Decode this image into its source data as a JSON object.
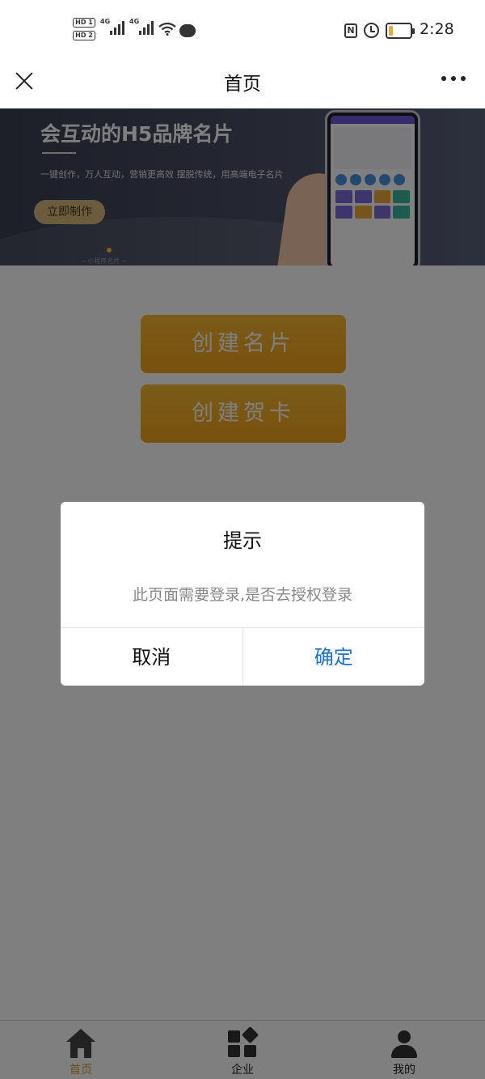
{
  "status_bar": {
    "hd1": "HD 1",
    "hd2": "HD 2",
    "net1": "4G",
    "net2": "4G",
    "nfc": "N",
    "time": "2:28",
    "battery_level": 0.2,
    "battery_color": "#f5a623",
    "icons": [
      "signal-icon",
      "wifi-icon",
      "message-icon",
      "nfc-icon",
      "alarm-icon",
      "battery-icon"
    ]
  },
  "navbar": {
    "title": "首页",
    "close_icon": "close-icon",
    "more_icon": "more-icon"
  },
  "banner": {
    "title": "会互动的H5品牌名片",
    "subtitle": "一键创作，万人互动，营销更高效   摆脱传统，用高端电子名片",
    "button_label": "立即制作",
    "caption": "-- 小程序名片 --"
  },
  "actions": {
    "create_card": "创建名片",
    "create_greeting_card": "创建贺卡",
    "accent_color": "#f0a21a"
  },
  "dialog": {
    "title": "提示",
    "message": "此页面需要登录,是否去授权登录",
    "cancel_label": "取消",
    "confirm_label": "确定",
    "confirm_color": "#1e73c8"
  },
  "tabbar": {
    "items": [
      {
        "label": "首页",
        "icon": "home-icon",
        "active": true
      },
      {
        "label": "企业",
        "icon": "enterprise-icon",
        "active": false
      },
      {
        "label": "我的",
        "icon": "profile-icon",
        "active": false
      }
    ],
    "active_color": "#d09b2c"
  }
}
